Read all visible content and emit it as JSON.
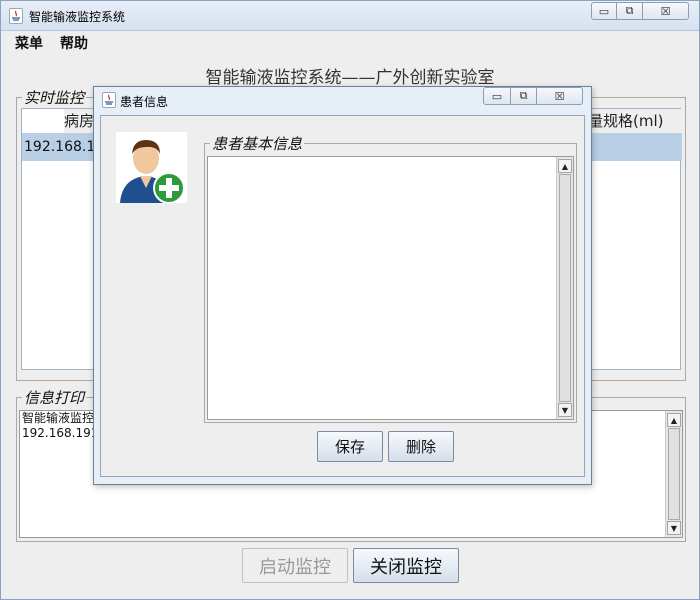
{
  "window": {
    "title": "智能输液监控系统",
    "controls": {
      "minimize": "▭",
      "restore": "⧉",
      "close": "☒"
    }
  },
  "menubar": {
    "items": [
      "菜单",
      "帮助"
    ]
  },
  "main_title": "智能输液监控系统——广外创新实验室",
  "realtime_panel": {
    "label": "实时监控",
    "columns": [
      "病房",
      "量规格(ml)"
    ],
    "rows": [
      {
        "ip": "192.168.1"
      }
    ]
  },
  "print_panel": {
    "label": "信息打印",
    "lines": [
      "智能输液监控",
      "192.168.191."
    ]
  },
  "buttons": {
    "start": "启动监控",
    "stop": "关闭监控"
  },
  "dialog": {
    "title": "患者信息",
    "controls": {
      "minimize": "▭",
      "restore": "⧉",
      "close": "☒"
    },
    "info_label": "患者基本信息",
    "info_text": "",
    "save": "保存",
    "delete": "删除"
  },
  "colors": {
    "selection": "#b8cfe5",
    "title_gradient_top": "#e8eef7",
    "avatar_plus": "#2e9a3b"
  },
  "icons": [
    "java-app-icon",
    "add-patient-avatar-icon",
    "scroll-up-icon",
    "scroll-down-icon"
  ]
}
